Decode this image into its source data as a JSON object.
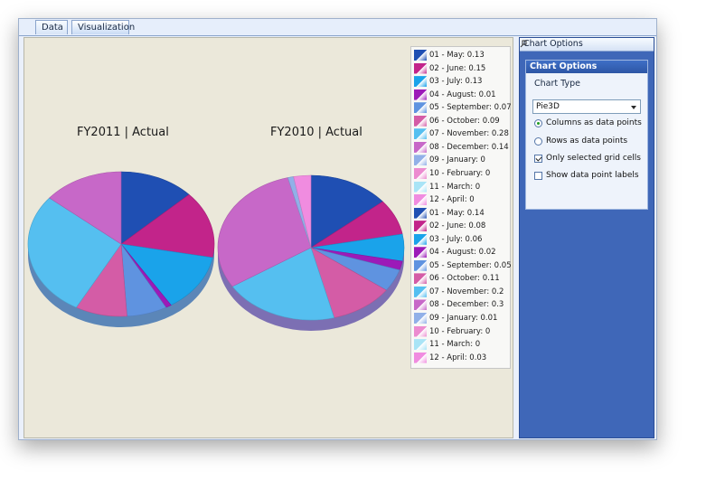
{
  "tabs": [
    {
      "label": "Data"
    },
    {
      "label": "Visualization"
    }
  ],
  "chart_data": {
    "type": "pie",
    "charts": [
      {
        "title": "FY2011 | Actual",
        "series_name": "FY2011",
        "labels": [
          "01 - May",
          "02 - June",
          "03 - July",
          "04 - August",
          "05 - September",
          "06 - October",
          "07 - November",
          "08 - December",
          "09 - January",
          "10 - February",
          "11 - March",
          "12 - April"
        ],
        "values": [
          0.13,
          0.15,
          0.13,
          0.01,
          0.07,
          0.09,
          0.28,
          0.14,
          0,
          0,
          0,
          0
        ]
      },
      {
        "title": "FY2010 | Actual",
        "series_name": "FY2010",
        "labels": [
          "01 - May",
          "02 - June",
          "03 - July",
          "04 - August",
          "05 - September",
          "06 - October",
          "07 - November",
          "08 - December",
          "09 - January",
          "10 - February",
          "11 - March",
          "12 - April"
        ],
        "values": [
          0.14,
          0.08,
          0.06,
          0.02,
          0.05,
          0.11,
          0.2,
          0.3,
          0.01,
          0,
          0,
          0.03
        ]
      }
    ],
    "colors": [
      "#1f4fb3",
      "#c2248a",
      "#1aa3ea",
      "#9c1ab8",
      "#5f93e0",
      "#d45ca6",
      "#55bff0",
      "#c768c8",
      "#91b0e8",
      "#ec8bd0",
      "#a9e4f6",
      "#f08ce0"
    ],
    "legend": [
      {
        "text": "01 - May: 0.13"
      },
      {
        "text": "02 - June: 0.15"
      },
      {
        "text": "03 - July: 0.13"
      },
      {
        "text": "04 - August: 0.01"
      },
      {
        "text": "05 - September: 0.07"
      },
      {
        "text": "06 - October: 0.09"
      },
      {
        "text": "07 - November: 0.28"
      },
      {
        "text": "08 - December: 0.14"
      },
      {
        "text": "09 - January: 0"
      },
      {
        "text": "10 - February: 0"
      },
      {
        "text": "11 - March: 0"
      },
      {
        "text": "12 - April: 0"
      },
      {
        "text": "01 - May: 0.14"
      },
      {
        "text": "02 - June: 0.08"
      },
      {
        "text": "03 - July: 0.06"
      },
      {
        "text": "04 - August: 0.02"
      },
      {
        "text": "05 - September: 0.05"
      },
      {
        "text": "06 - October: 0.11"
      },
      {
        "text": "07 - November: 0.2"
      },
      {
        "text": "08 - December: 0.3"
      },
      {
        "text": "09 - January: 0.01"
      },
      {
        "text": "10 - February: 0"
      },
      {
        "text": "11 - March: 0"
      },
      {
        "text": "12 - April: 0.03"
      }
    ],
    "legend_placement": "right"
  },
  "options_panel": {
    "window_title": "Chart Options",
    "panel_title": "Chart Options",
    "chart_type_label": "Chart Type",
    "chart_type_value": "Pie3D",
    "radios": [
      {
        "label": "Columns as data points",
        "checked": true
      },
      {
        "label": "Rows as data points",
        "checked": false
      }
    ],
    "checkboxes": [
      {
        "label": "Only selected grid cells",
        "checked": true
      },
      {
        "label": "Show data point labels",
        "checked": false
      }
    ]
  }
}
